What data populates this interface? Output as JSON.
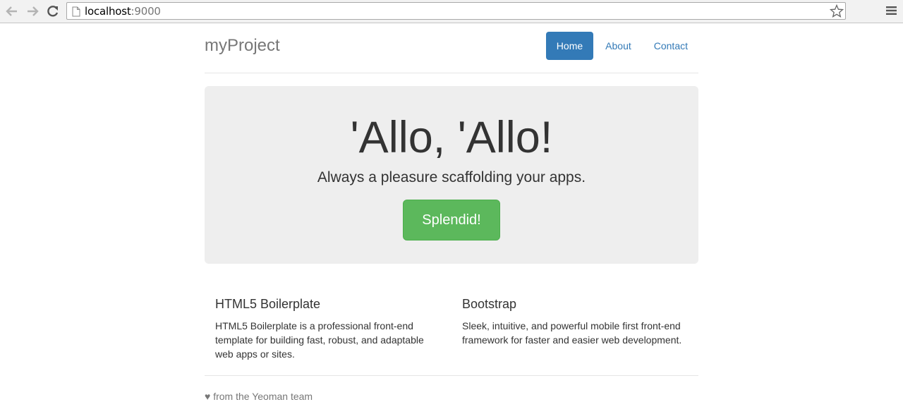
{
  "browser": {
    "url_host": "localhost",
    "url_port": ":9000"
  },
  "header": {
    "brand": "myProject",
    "nav": [
      {
        "label": "Home",
        "active": true
      },
      {
        "label": "About",
        "active": false
      },
      {
        "label": "Contact",
        "active": false
      }
    ]
  },
  "jumbotron": {
    "title": "'Allo, 'Allo!",
    "lead": "Always a pleasure scaffolding your apps.",
    "button": "Splendid!"
  },
  "marketing": [
    {
      "heading": "HTML5 Boilerplate",
      "text": "HTML5 Boilerplate is a professional front-end template for building fast, robust, and adaptable web apps or sites."
    },
    {
      "heading": "Bootstrap",
      "text": "Sleek, intuitive, and powerful mobile first front-end framework for faster and easier web development."
    }
  ],
  "footer": {
    "text": "♥ from the Yeoman team"
  },
  "colors": {
    "primary": "#337ab7",
    "success": "#5cb85c",
    "jumbotron_bg": "#eeeeee"
  }
}
